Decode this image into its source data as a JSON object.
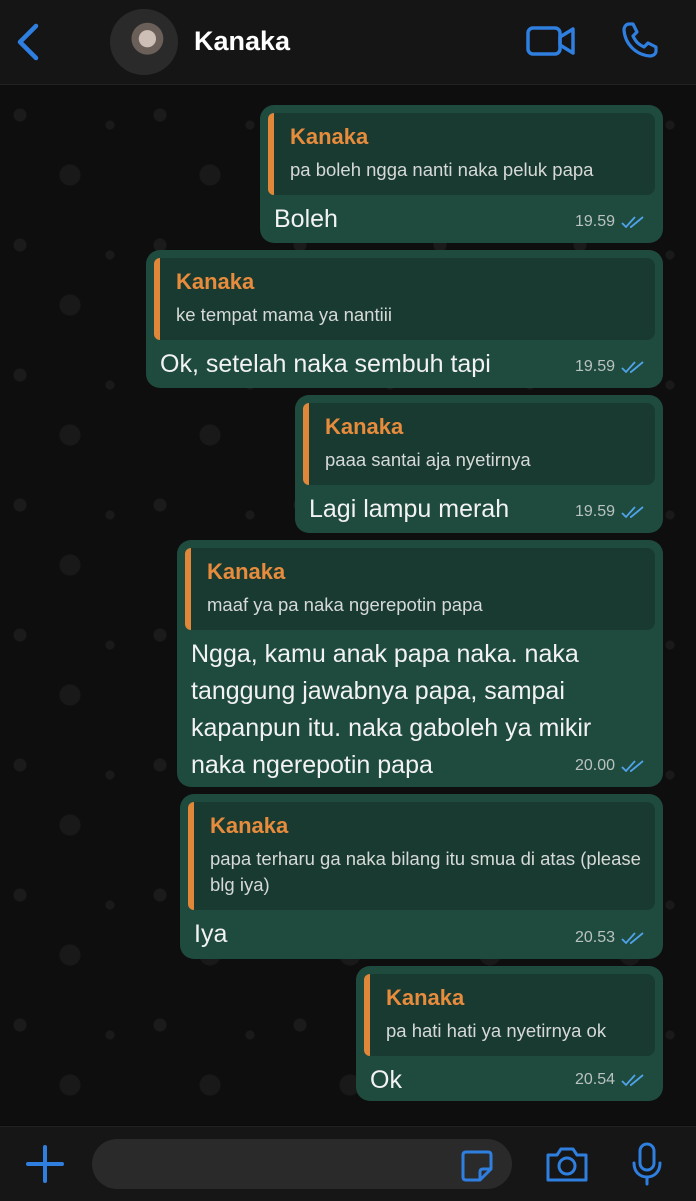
{
  "header": {
    "contact_name": "Kanaka",
    "icons": [
      "back-chevron-icon",
      "avatar",
      "video-call-icon",
      "phone-call-icon"
    ]
  },
  "messages": [
    {
      "quoted_name": "Kanaka",
      "quoted_text": "pa boleh ngga nanti naka peluk papa",
      "text": "Boleh",
      "time": "19.59",
      "status": "read"
    },
    {
      "quoted_name": "Kanaka",
      "quoted_text": "ke tempat mama ya nantiii",
      "text": "Ok, setelah naka sembuh tapi",
      "time": "19.59",
      "status": "read"
    },
    {
      "quoted_name": "Kanaka",
      "quoted_text": "paaa santai aja nyetirnya",
      "text": "Lagi lampu merah",
      "time": "19.59",
      "status": "read"
    },
    {
      "quoted_name": "Kanaka",
      "quoted_text": "maaf ya pa naka ngerepotin papa",
      "text": "Ngga, kamu anak papa naka. naka tanggung jawabnya papa, sampai kapanpun itu. naka gaboleh ya mikir naka ngerepotin papa",
      "time": "20.00",
      "status": "read"
    },
    {
      "quoted_name": "Kanaka",
      "quoted_text": "papa terharu ga naka bilang itu smua di atas (please blg iya)",
      "text": "Iya",
      "time": "20.53",
      "status": "read"
    },
    {
      "quoted_name": "Kanaka",
      "quoted_text": "pa hati hati ya nyetirnya ok",
      "text": "Ok",
      "time": "20.54",
      "status": "read"
    }
  ],
  "input_bar": {
    "placeholder": "",
    "icons": [
      "plus-icon",
      "sticker-icon",
      "camera-icon",
      "microphone-icon"
    ]
  },
  "colors": {
    "accent": "#2f7fe0",
    "bubble": "#1f4b3f",
    "quote_bar": "#e0873a",
    "quote_name": "#e78b3c",
    "read_ticks": "#4fa3e8"
  }
}
